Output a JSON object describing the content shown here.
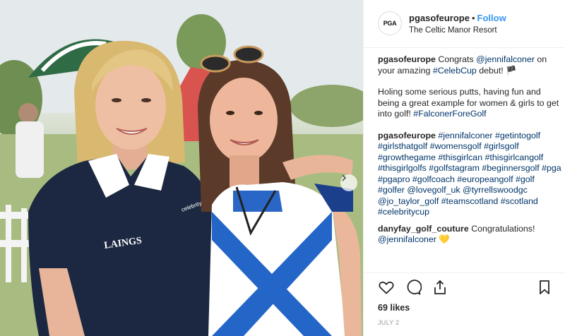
{
  "post": {
    "username": "pgasofeurope",
    "follow_label": "Follow",
    "location": "The Celtic Manor Resort",
    "avatar_text": "PGA"
  },
  "caption": {
    "username": "pgasofeurope",
    "pre": "Congrats ",
    "mention": "@jennifalconer",
    "mid": " on your amazing ",
    "hashtag": "#CelebCup",
    "mid2": " debut! ",
    "flag": "🏴",
    "para2": "Holing some serious putts, having fun and being a great example for women & girls to get into golf! ",
    "para2_tag": "#FalconerForeGolf"
  },
  "comments": [
    {
      "username": "pgasofeurope",
      "text": "#jennifalconer #getintogolf #girlsthatgolf #womensgolf #girlsgolf #growthegame #thisgirlcan #thisgirlcangolf #thisgirlgolfs #golfstagram #beginnersgolf #pga #pgapro #golfcoach #europeangolf #golf #golfer @lovegolf_uk @tyrrellswoodgc @jo_taylor_golf #teamscotland #scotland #celebritycup"
    },
    {
      "username": "danyfay_golf_couture",
      "text": "Congratulations!",
      "mention": "@jennifalconer",
      "emoji": "💛"
    }
  ],
  "likes_text": "69 likes",
  "date_text": "JULY 2",
  "icons": [
    "heart-icon",
    "comment-icon",
    "share-icon",
    "bookmark-icon",
    "chevron-right-icon"
  ],
  "colors": {
    "link": "#3897f0",
    "tag": "#003569",
    "muted": "#999999"
  },
  "photo": {
    "shirt_logo": "LAINGS",
    "shirt_logo_sub": "celebrity cup"
  }
}
